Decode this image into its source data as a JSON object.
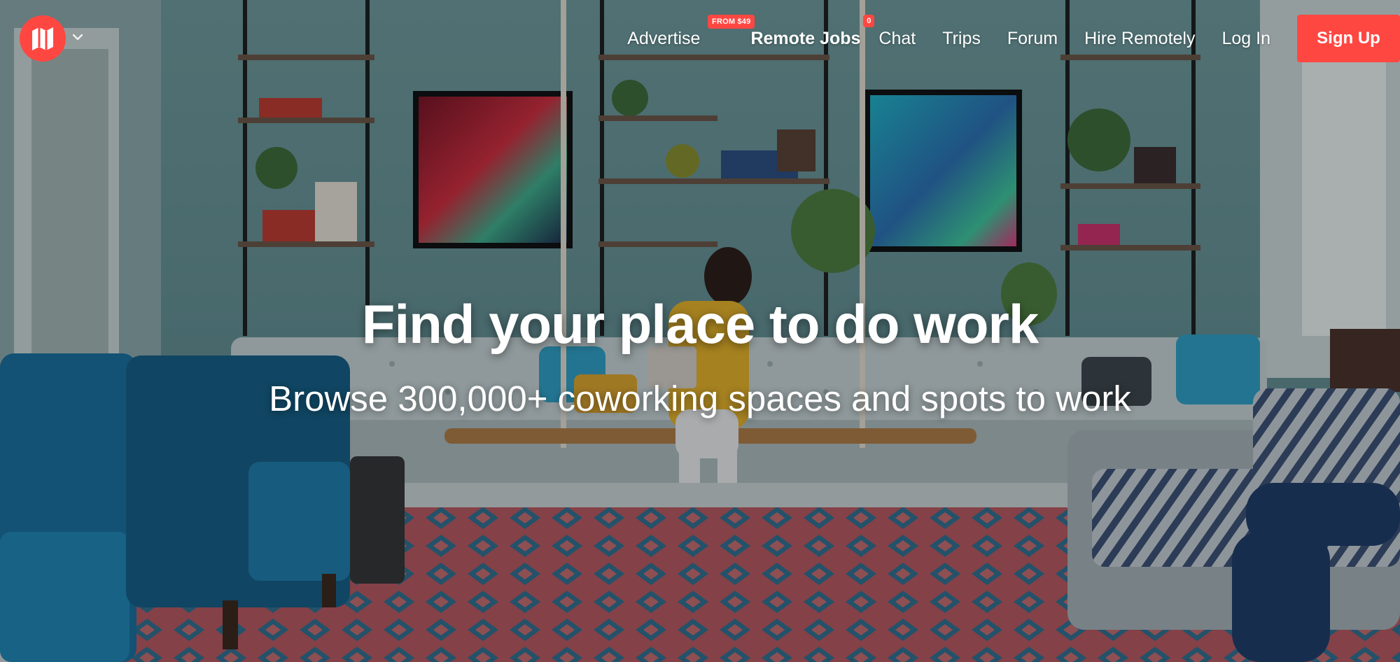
{
  "nav": {
    "items": [
      {
        "label": "Advertise",
        "badge": "FROM $49"
      },
      {
        "label": "Remote Jobs",
        "badge": "0"
      },
      {
        "label": "Chat"
      },
      {
        "label": "Trips"
      },
      {
        "label": "Forum"
      },
      {
        "label": "Hire Remotely"
      },
      {
        "label": "Log In"
      }
    ],
    "signup_label": "Sign Up"
  },
  "hero": {
    "headline": "Find your place to do work",
    "subheadline": "Browse 300,000+ coworking spaces and spots to work"
  },
  "icons": {
    "logo": "map-logo-icon",
    "caret": "chevron-down-icon"
  },
  "colors": {
    "accent": "#ff4742",
    "text": "#ffffff"
  }
}
